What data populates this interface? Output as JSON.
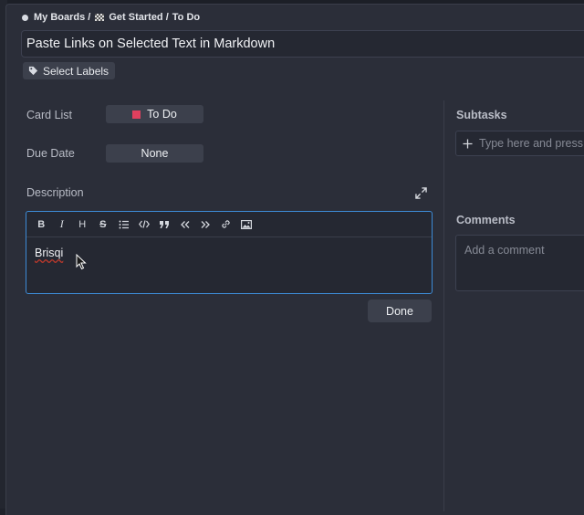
{
  "breadcrumb": {
    "board_root": "My Boards /",
    "board_name": "Get Started /",
    "list_name": "To Do"
  },
  "card": {
    "title": "Paste Links on Selected Text in Markdown"
  },
  "labels": {
    "button_label": "Select Labels"
  },
  "fields": {
    "card_list_label": "Card List",
    "card_list_value": "To Do",
    "card_list_color": "#e0405e",
    "due_date_label": "Due Date",
    "due_date_value": "None"
  },
  "description": {
    "label": "Description",
    "toolbar": [
      "B",
      "I",
      "H",
      "S",
      "list",
      "code",
      "quote",
      "undo",
      "redo",
      "link",
      "image"
    ],
    "content": "Brisqi",
    "done_label": "Done",
    "focus_color": "#3d8bd6"
  },
  "subtasks": {
    "label": "Subtasks",
    "placeholder": "Type here and press"
  },
  "comments": {
    "label": "Comments",
    "placeholder": "Add a comment"
  }
}
